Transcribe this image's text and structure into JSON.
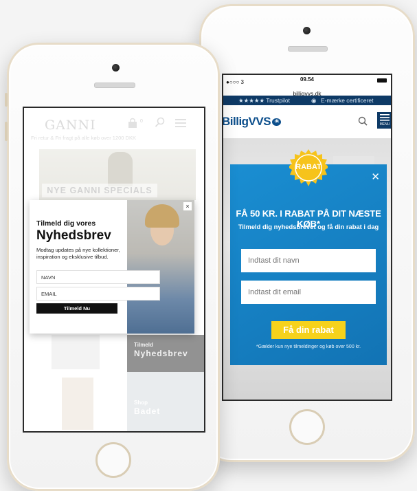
{
  "back_phone": {
    "status": {
      "carrier": "●○○○ 3",
      "time": "09.54",
      "url": "billigvvs.dk"
    },
    "trustbar": {
      "trustpilot": "★★★★★ Trustpilot",
      "emaerke": "E-mærke certificeret"
    },
    "header": {
      "logo": "BilligVVS",
      "logo_suffix": "dk",
      "menu_label": "MENU"
    },
    "popup": {
      "badge": "RABAT",
      "headline": "FÅ 50 KR. I RABAT PÅ DIT NÆSTE KØB*",
      "subheadline": "Tilmeld dig nyhedsbrevet og få din rabat i dag",
      "name_placeholder": "Indtast dit navn",
      "email_placeholder": "Indtast dit email",
      "button": "Få din rabat",
      "note": "*Gælder kun nye tilmeldinger og køb over 500 kr."
    },
    "colors": {
      "accent": "#1a8ed2",
      "button": "#f6d21b",
      "trustbar": "#0e3a66"
    }
  },
  "front_phone": {
    "header": {
      "logo": "GANNI",
      "cart_count": "0",
      "shipping": "Fri retur & Fri fragt på alle køb over 1200 DKK"
    },
    "banner": {
      "label": "NYE GANNI SPECIALS"
    },
    "popup": {
      "line1": "Tilmeld dig vores",
      "line2": "Nyhedsbrev",
      "body": "Modtag updates på nye kollektioner, inspiration og eksklusive tilbud.",
      "name_placeholder": "NAVN",
      "email_placeholder": "EMAIL",
      "button": "Tilmeld Nu",
      "close": "×"
    },
    "tiles": {
      "newsletter_small": "Tilmeld",
      "newsletter_big": "Nyhedsbrev",
      "shop": "Shop",
      "shop_big": "Badet"
    }
  }
}
